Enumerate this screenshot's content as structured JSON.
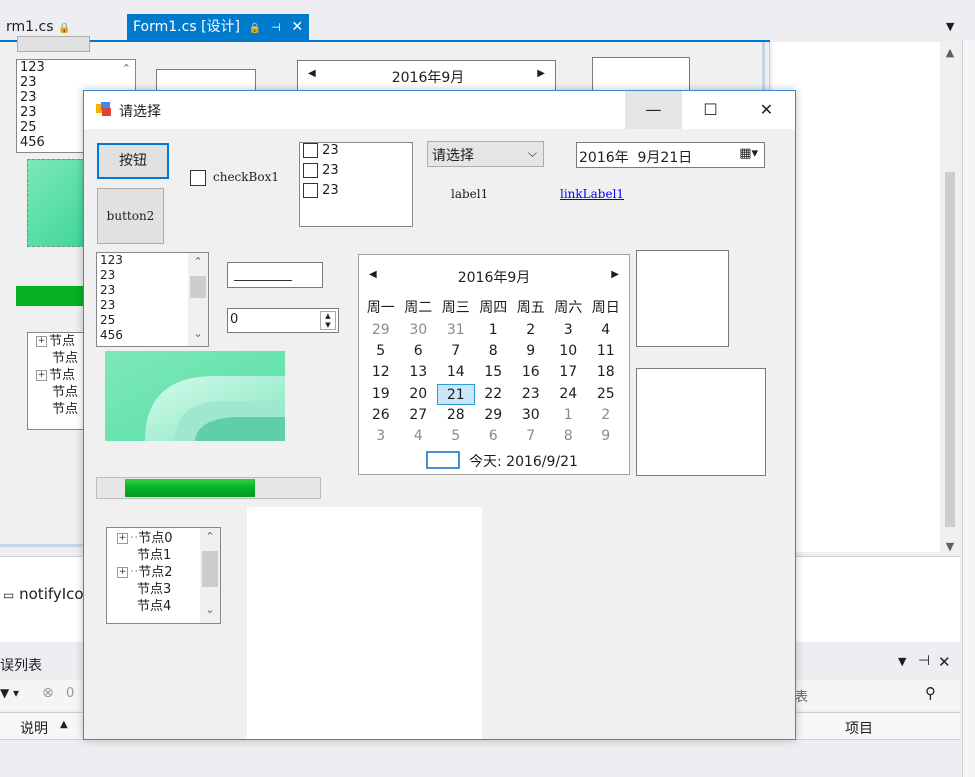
{
  "ide": {
    "tabs": [
      {
        "label": "rm1.cs",
        "active": false
      },
      {
        "label": "Form1.cs [设计]",
        "active": true
      }
    ],
    "tray_item": "notifyIco",
    "error_list": {
      "title": "误列表",
      "errors_count": "0",
      "search_placeholder": "表",
      "col_description": "说明",
      "col_project": "项目"
    },
    "bg_form": {
      "listbox": [
        "123",
        "23",
        "23",
        "23",
        "25",
        "456"
      ],
      "date_header": "2016年9月",
      "tree": [
        "节点",
        "节点",
        "节点",
        "节点",
        "节点"
      ]
    }
  },
  "dialog": {
    "title": "请选择",
    "controls": {
      "button1": "按钮",
      "button2": "button2",
      "checkbox": "checkBox1",
      "checked_list": [
        "23",
        "23",
        "23"
      ],
      "combo": "请选择",
      "label": "label1",
      "link": "linkLabel1",
      "datepicker": "2016年  9月21日",
      "listbox": [
        "123",
        "23",
        "23",
        "23",
        "25",
        "456"
      ],
      "numeric": "0"
    },
    "calendar": {
      "header": "2016年9月",
      "weekdays": [
        "周一",
        "周二",
        "周三",
        "周四",
        "周五",
        "周六",
        "周日"
      ],
      "weeks": [
        [
          [
            "29",
            1
          ],
          [
            "30",
            1
          ],
          [
            "31",
            1
          ],
          [
            "1",
            0
          ],
          [
            "2",
            0
          ],
          [
            "3",
            0
          ],
          [
            "4",
            0
          ]
        ],
        [
          [
            "5",
            0
          ],
          [
            "6",
            0
          ],
          [
            "7",
            0
          ],
          [
            "8",
            0
          ],
          [
            "9",
            0
          ],
          [
            "10",
            0
          ],
          [
            "11",
            0
          ]
        ],
        [
          [
            "12",
            0
          ],
          [
            "13",
            0
          ],
          [
            "14",
            0
          ],
          [
            "15",
            0
          ],
          [
            "16",
            0
          ],
          [
            "17",
            0
          ],
          [
            "18",
            0
          ]
        ],
        [
          [
            "19",
            0
          ],
          [
            "20",
            0
          ],
          [
            "21",
            2
          ],
          [
            "22",
            0
          ],
          [
            "23",
            0
          ],
          [
            "24",
            0
          ],
          [
            "25",
            0
          ]
        ],
        [
          [
            "26",
            0
          ],
          [
            "27",
            0
          ],
          [
            "28",
            0
          ],
          [
            "29",
            0
          ],
          [
            "30",
            0
          ],
          [
            "1",
            1
          ],
          [
            "2",
            1
          ]
        ],
        [
          [
            "3",
            1
          ],
          [
            "4",
            1
          ],
          [
            "5",
            1
          ],
          [
            "6",
            1
          ],
          [
            "7",
            1
          ],
          [
            "8",
            1
          ],
          [
            "9",
            1
          ]
        ]
      ],
      "today": "今天: 2016/9/21"
    },
    "tree": [
      "节点0",
      "节点1",
      "节点2",
      "节点3",
      "节点4"
    ],
    "tree_expandable": [
      true,
      false,
      true,
      false,
      false
    ],
    "progress_value": 0.71
  },
  "colors": {
    "accent": "#007acc",
    "progress": "#06b025",
    "link": "#0000ff"
  }
}
